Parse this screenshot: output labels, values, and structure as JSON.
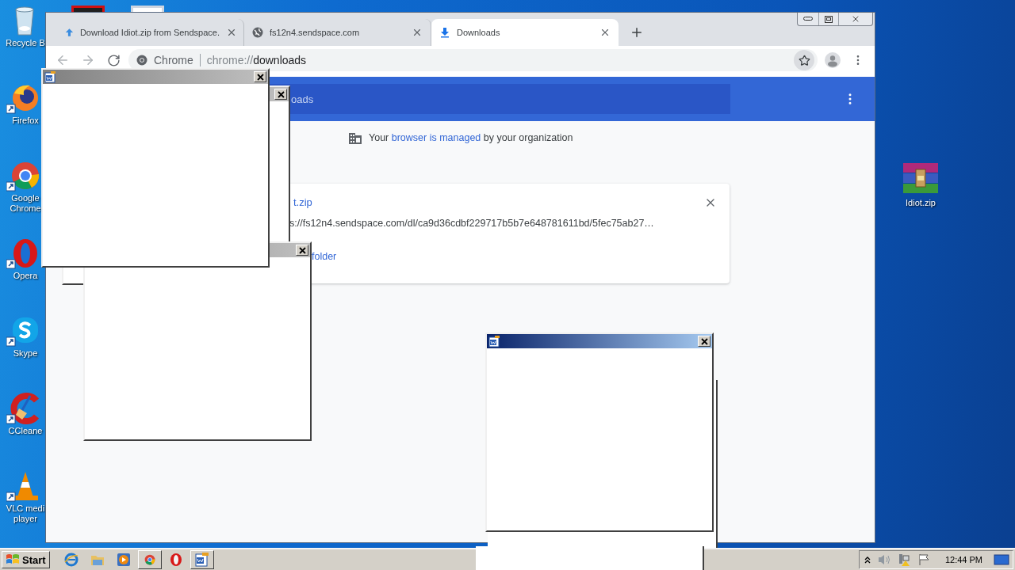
{
  "desktop_icons": [
    {
      "kind": "recycle",
      "label": "Recycle B"
    },
    {
      "kind": "firefox",
      "label": "Firefox"
    },
    {
      "kind": "chrome",
      "label": "Google Chrome"
    },
    {
      "kind": "opera",
      "label": "Opera"
    },
    {
      "kind": "skype",
      "label": "Skype"
    },
    {
      "kind": "ccleaner",
      "label": "CCleane"
    },
    {
      "kind": "vlc",
      "label": "VLC medi player"
    }
  ],
  "desktop_file": {
    "label": "Idiot.zip"
  },
  "browser": {
    "tabs": [
      {
        "kind": "upload",
        "title": "Download Idiot.zip from Sendspace.",
        "selected": false
      },
      {
        "kind": "globe",
        "title": "fs12n4.sendspace.com",
        "selected": false
      },
      {
        "kind": "download",
        "title": "Downloads",
        "selected": true
      }
    ],
    "omnibox": {
      "chip": "Chrome",
      "url_scheme": "chrome://",
      "url_path": "downloads"
    },
    "header_text": "oads",
    "notice": {
      "before": "Your",
      "link": "browser is managed",
      "after": "by your organization"
    },
    "download": {
      "name": "t.zip",
      "url": "s://fs12n4.sendspace.com/dl/ca9d36cdbf229717b5b7e648781611bd/5fec75ab27…",
      "action": "folder"
    }
  },
  "popups": [
    {
      "active": false
    },
    {
      "active": false
    },
    {
      "active": false
    },
    {
      "active": true
    }
  ],
  "taskbar": {
    "start": "Start",
    "apps": [
      {
        "kind": "ie",
        "selected": false
      },
      {
        "kind": "explorer",
        "selected": false
      },
      {
        "kind": "media",
        "selected": false
      },
      {
        "kind": "chrome",
        "selected": true
      },
      {
        "kind": "opera",
        "selected": false
      },
      {
        "kind": "word",
        "selected": true
      }
    ],
    "clock": "12:44 PM"
  }
}
